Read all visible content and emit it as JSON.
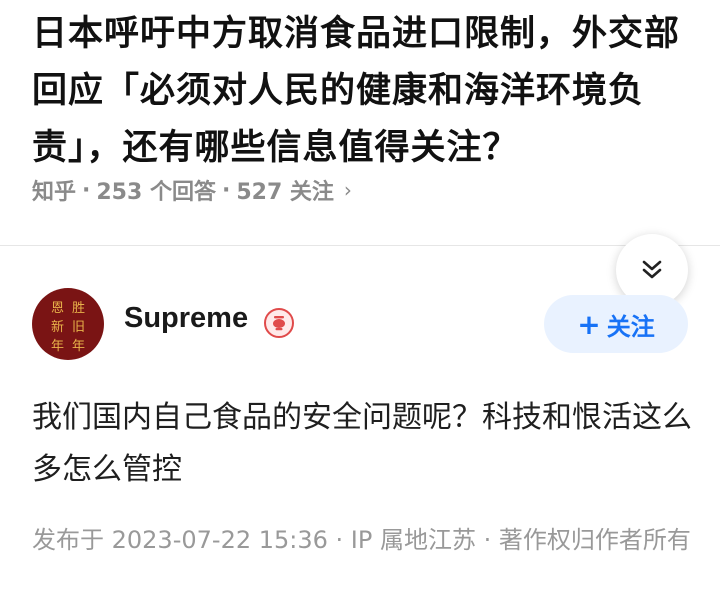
{
  "question": {
    "title": "日本呼吁中方取消食品进口限制，外交部回应「必须对人民的健康和海洋环境负责」，还有哪些信息值得关注？",
    "source": "知乎",
    "answer_count": "253 个回答",
    "follower_count": "527 关注",
    "separator": "·",
    "more_chevron": "›"
  },
  "collapse_icon": "double-chevron-down-icon",
  "author": {
    "name": "Supreme",
    "avatar_chars": [
      "恩",
      "胜",
      "新",
      "旧",
      "年",
      "年"
    ],
    "badge_icon": "lantern-badge-icon"
  },
  "follow_button": {
    "plus": "+",
    "label": "关注"
  },
  "answer": {
    "text": "我们国内自己食品的安全问题呢？科技和恨活这么多怎么管控"
  },
  "publish_info": "发布于 2023-07-22 15:36 · IP 属地江苏 · 著作权归作者所有",
  "colors": {
    "accent": "#1772f6",
    "follow_bg": "#e9f2ff",
    "meta_gray": "#8a8a8a",
    "avatar_bg": "#7a1414"
  }
}
